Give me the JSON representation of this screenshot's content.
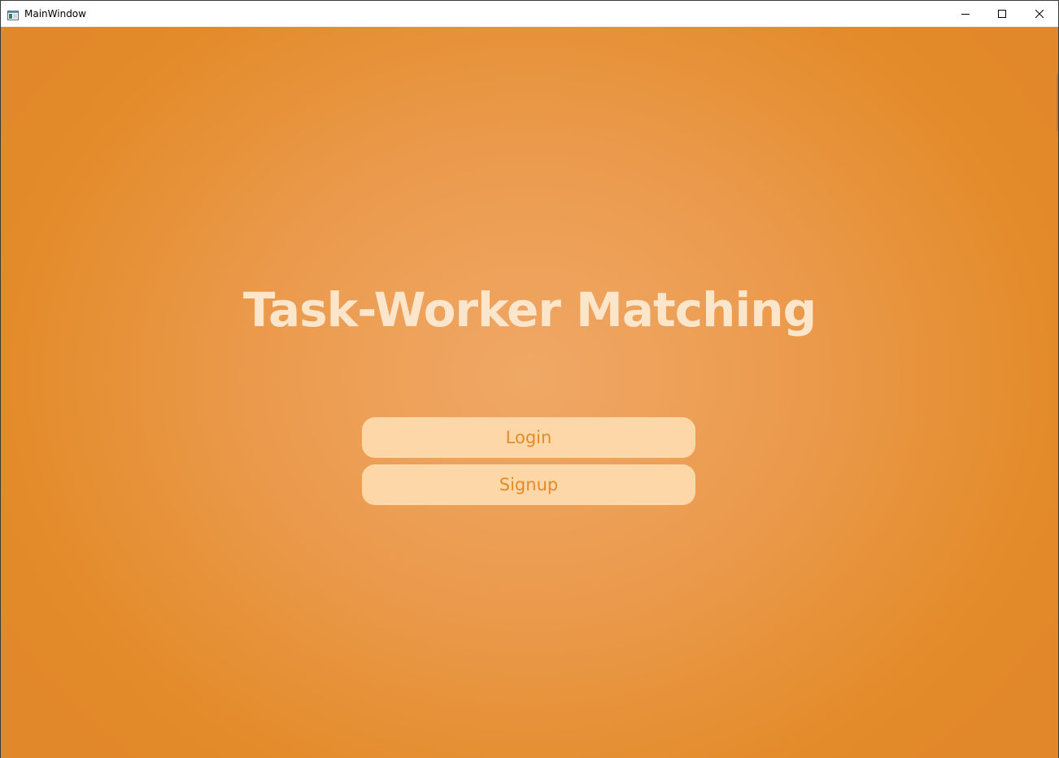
{
  "window": {
    "title": "MainWindow",
    "controls": {
      "minimize": "minimize-icon",
      "maximize": "maximize-icon",
      "close": "close-icon"
    }
  },
  "main": {
    "heading": "Task-Worker Matching",
    "login_label": "Login",
    "signup_label": "Signup"
  },
  "colors": {
    "background_center": "#f0a866",
    "background_edge": "#e1882a",
    "heading_text": "#fbe5cb",
    "button_fill": "#fdd7a8",
    "button_text": "#e38b2a"
  }
}
